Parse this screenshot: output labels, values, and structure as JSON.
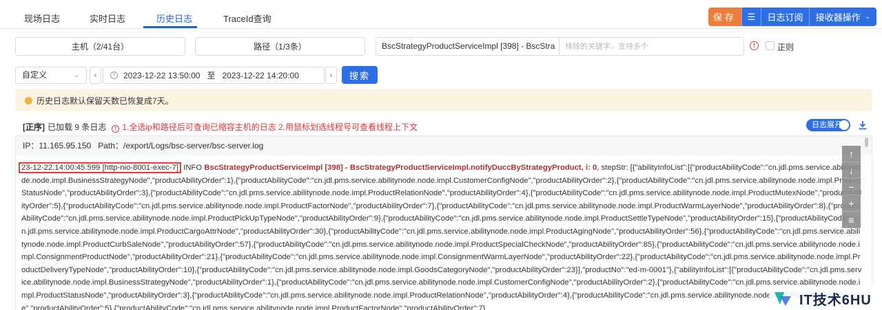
{
  "tabs": [
    {
      "label": "现场日志"
    },
    {
      "label": "实时日志"
    },
    {
      "label": "历史日志"
    },
    {
      "label": "TraceId查询"
    }
  ],
  "toolbar": {
    "save_label": "保存",
    "subscribe_label": "日志订阅",
    "receiver_label": "接收器操作"
  },
  "filters": {
    "host_label": "主机（2/41台）",
    "path_label": "路径（1/3条）",
    "path_value": "BscStrategyProductServiceImpl [398] - BscStra",
    "keyword_placeholder": "排除的关键字，支持多个",
    "regex_label": "正则"
  },
  "time": {
    "mode": "自定义",
    "start": "2023-12-22 13:50:00",
    "to_label": "至",
    "end": "2023-12-22 14:20:00",
    "search_label": "搜索"
  },
  "notice": "历史日志默认保留天数已恢复成7天。",
  "status": {
    "order": "[正序]",
    "loaded": "已加载 9 条日志",
    "tip": "1.全选ip和路径后可查询已缩容主机的日志  2.用鼠标划选线程号可查看线程上下文",
    "expand_label": "日志展开"
  },
  "log": {
    "ip_line": "IP：11.165.95.150",
    "path_line": "Path：/export/Logs/bsc-server/bsc-server.log",
    "timestamp": "23-12-22.14:00:45.599 [http-nio-8001-exec-7]",
    "level": " INFO ",
    "class_part": "BscStrategyProductServiceImpl [398] - BscStrategyProductServiceImpl.notifyDuccByStrategyProduct, i: 0",
    "content": ", stepStr: [{\"abilityInfoList\":[{\"productAbilityCode\":\"cn.jdl.pms.service.abilitynode.node.impl.BusinessStrategyNode\",\"productAbilityOrder\":1},{\"productAbilityCode\":\"cn.jdl.pms.service.abilitynode.node.impl.CustomerConfigNode\",\"productAbilityOrder\":2},{\"productAbilityCode\":\"cn.jdl.pms.service.abilitynode.node.impl.ProductStatusNode\",\"productAbilityOrder\":3},{\"productAbilityCode\":\"cn.jdl.pms.service.abilitynode.node.impl.ProductRelationNode\",\"productAbilityOrder\":4},{\"productAbilityCode\":\"cn.jdl.pms.service.abilitynode.node.impl.ProductMutexNode\",\"productAbilityOrder\":5},{\"productAbilityCode\":\"cn.jdl.pms.service.abilitynode.node.impl.ProductFactorNode\",\"productAbilityOrder\":7},{\"productAbilityCode\":\"cn.jdl.pms.service.abilitynode.node.impl.ProductWarmLayerNode\",\"productAbilityOrder\":8},{\"productAbilityCode\":\"cn.jdl.pms.service.abilitynode.node.impl.ProductPickUpTypeNode\",\"productAbilityOrder\":9},{\"productAbilityCode\":\"cn.jdl.pms.service.abilitynode.node.impl.ProductSettleTypeNode\",\"productAbilityOrder\":15},{\"productAbilityCode\":\"cn.jdl.pms.service.abilitynode.node.impl.ProductCargoAttrNode\",\"productAbilityOrder\":30},{\"productAbilityCode\":\"cn.jdl.pms.service.abilitynode.node.impl.ProductAgingNode\",\"productAbilityOrder\":56},{\"productAbilityCode\":\"cn.jdl.pms.service.abilitynode.node.impl.ProductCurbSaleNode\",\"productAbilityOrder\":57},{\"productAbilityCode\":\"cn.jdl.pms.service.abilitynode.node.impl.ProductSpecialCheckNode\",\"productAbilityOrder\":85},{\"productAbilityCode\":\"cn.jdl.pms.service.abilitynode.node.impl.ConsignmentProductNode\",\"productAbilityOrder\":21},{\"productAbilityCode\":\"cn.jdl.pms.service.abilitynode.node.impl.ConsignmentWarmLayerNode\",\"productAbilityOrder\":22},{\"productAbilityCode\":\"cn.jdl.pms.service.abilitynode.node.impl.ProductDeliveryTypeNode\",\"productAbilityOrder\":10},{\"productAbilityCode\":\"cn.jdl.pms.service.abilitynode.node.impl.GoodsCategoryNode\",\"productAbilityOrder\":23}],\"productNo\":\"ed-m-0001\"},{\"abilityInfoList\":[{\"productAbilityCode\":\"cn.jdl.pms.service.abilitynode.node.impl.BusinessStrategyNode\",\"productAbilityOrder\":1},{\"productAbilityCode\":\"cn.jdl.pms.service.abilitynode.node.impl.CustomerConfigNode\",\"productAbilityOrder\":2},{\"productAbilityCode\":\"cn.jdl.pms.service.abilitynode.node.impl.ProductStatusNode\",\"productAbilityOrder\":3},{\"productAbilityCode\":\"cn.jdl.pms.service.abilitynode.node.impl.ProductRelationNode\",\"productAbilityOrder\":4},{\"productAbilityCode\":\"cn.jdl.pms.service.abilitynode.node.impl.ProductMutexNode\",\"productAbilityOrder\":5},{\"productAbilityCode\":\"cn.jdl.pms.service.abilitynode.node.impl.ProductFactorNode\",\"productAbilityOrder\":7}"
  },
  "watermark": "IT技术6HU",
  "colors": {
    "accent": "#2f6fe4",
    "save": "#f07c3c",
    "warning": "#d9363e",
    "notice_bg": "#fdf5e3"
  }
}
